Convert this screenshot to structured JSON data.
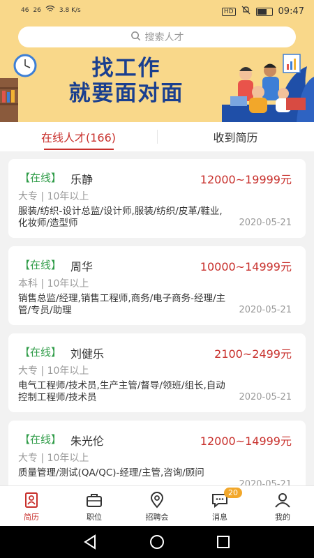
{
  "status_bar": {
    "signal1": "46",
    "signal2": "26",
    "speed": "3.8 K/s",
    "hd": "HD",
    "time": "09:47"
  },
  "search": {
    "placeholder": "搜索人才"
  },
  "banner": {
    "line1": "找工作",
    "line2": "就要面对面"
  },
  "tabs": [
    {
      "label": "在线人才(166)",
      "active": true
    },
    {
      "label": "收到简历",
      "active": false
    }
  ],
  "candidates": [
    {
      "status": "【在线】",
      "name": "乐静",
      "salary": "12000~19999元",
      "edu": "大专 | 10年以上",
      "jobs": "服装/纺织-设计总监/设计师,服装/纺织/皮革/鞋业,化妆师/造型师",
      "date": "2020-05-21"
    },
    {
      "status": "【在线】",
      "name": "周华",
      "salary": "10000~14999元",
      "edu": "本科 | 10年以上",
      "jobs": "销售总监/经理,销售工程师,商务/电子商务-经理/主管/专员/助理",
      "date": "2020-05-21"
    },
    {
      "status": "【在线】",
      "name": "刘健乐",
      "salary": "2100~2499元",
      "edu": "大专 | 10年以上",
      "jobs": "电气工程师/技术员,生产主管/督导/领班/组长,自动控制工程师/技术员",
      "date": "2020-05-21"
    },
    {
      "status": "【在线】",
      "name": "朱光伦",
      "salary": "12000~14999元",
      "edu": "大专 | 10年以上",
      "jobs": "质量管理/测试(QA/QC)-经理/主管,咨询/顾问",
      "date": "2020-05-21"
    }
  ],
  "bottom_nav": [
    {
      "label": "简历",
      "icon": "resume-icon",
      "active": true
    },
    {
      "label": "职位",
      "icon": "briefcase-icon",
      "active": false
    },
    {
      "label": "招聘会",
      "icon": "location-icon",
      "active": false
    },
    {
      "label": "消息",
      "icon": "message-icon",
      "active": false,
      "badge": "20"
    },
    {
      "label": "我的",
      "icon": "profile-icon",
      "active": false
    }
  ],
  "colors": {
    "accent": "#c8302c",
    "online": "#2f9c48",
    "banner_bg": "#f9d88a",
    "banner_text": "#1a3f8f",
    "badge": "#f2a72a"
  }
}
